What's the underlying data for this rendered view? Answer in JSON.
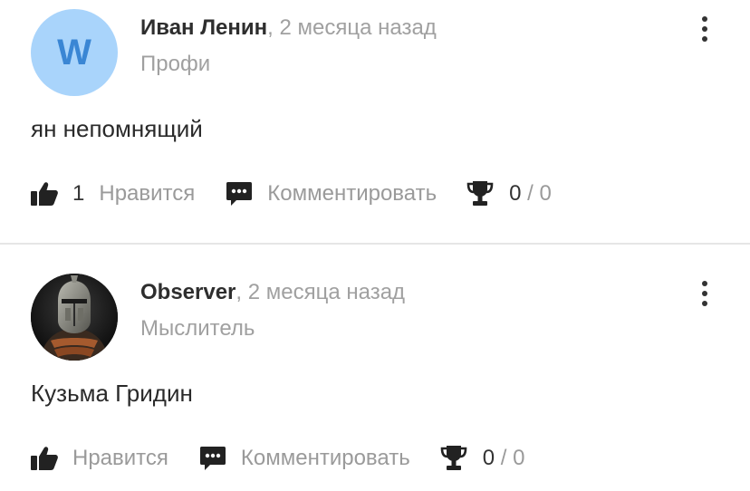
{
  "answers": [
    {
      "author_name": "Иван Ленин",
      "time_separator": ", ",
      "time": "2 месяца назад",
      "rank": "Профи",
      "avatar_letter": "W",
      "text": "ян непомнящий",
      "like_count": "1",
      "like_label": "Нравится",
      "comment_label": "Комментировать",
      "score_value": "0",
      "score_separator": " / ",
      "score_max": "0"
    },
    {
      "author_name": "Observer",
      "time_separator": ", ",
      "time": "2 месяца назад",
      "rank": "Мыслитель",
      "text": "Кузьма Гридин",
      "like_label": "Нравится",
      "comment_label": "Комментировать",
      "score_value": "0",
      "score_separator": " / ",
      "score_max": "0"
    }
  ],
  "icons": {
    "like": "thumbs-up-icon",
    "comment": "comment-icon",
    "trophy": "trophy-icon",
    "more": "more-vertical-icon"
  },
  "colors": {
    "avatar_bg": "#a9d4fb",
    "avatar_letter": "#3a86d4",
    "name": "#2e2e2e",
    "muted": "#a0a0a0"
  }
}
